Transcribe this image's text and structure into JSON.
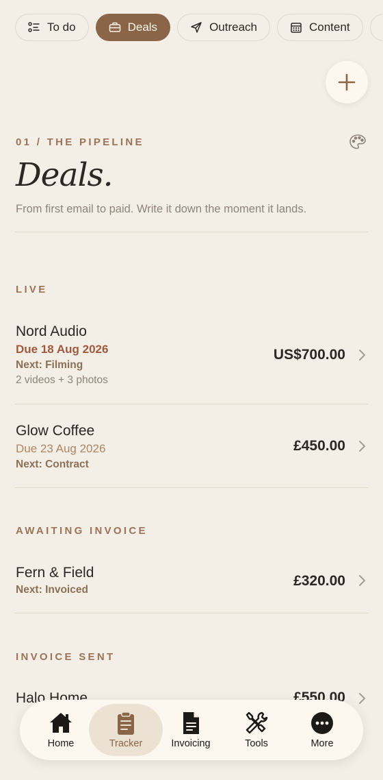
{
  "tabs": [
    {
      "label": "To do",
      "icon": "checklist-icon"
    },
    {
      "label": "Deals",
      "icon": "briefcase-icon",
      "active": true
    },
    {
      "label": "Outreach",
      "icon": "paper-plane-icon"
    },
    {
      "label": "Content",
      "icon": "calendar-icon"
    }
  ],
  "header": {
    "eyebrow": "01 / THE PIPELINE",
    "title": "Deals.",
    "subtitle": "From first email to paid. Write it down the moment it lands."
  },
  "sections": {
    "live": "LIVE",
    "awaiting_invoice": "AWAITING INVOICE",
    "invoice_sent": "INVOICE SENT"
  },
  "deals": [
    {
      "name": "Nord Audio",
      "due": "Due 18 Aug 2026",
      "next": "Next: Filming",
      "meta": "2 videos + 3 photos",
      "amount": "US$700.00"
    },
    {
      "name": "Glow Coffee",
      "due": "Due 23 Aug 2026",
      "next": "Next: Contract",
      "amount": "£450.00"
    },
    {
      "name": "Fern & Field",
      "next": "Next: Invoiced",
      "amount": "£320.00"
    },
    {
      "name": "Halo Home",
      "amount": "£550.00"
    }
  ],
  "nav": [
    {
      "label": "Home",
      "icon": "home-icon"
    },
    {
      "label": "Tracker",
      "icon": "clipboard-icon",
      "active": true
    },
    {
      "label": "Invoicing",
      "icon": "document-icon"
    },
    {
      "label": "Tools",
      "icon": "tools-icon"
    },
    {
      "label": "More",
      "icon": "more-icon"
    }
  ],
  "colors": {
    "background": "#f3eee6",
    "accent": "#8b6547",
    "due_urgent": "#a0593f",
    "due_soft": "#b08562",
    "eyebrow": "#9a7358"
  }
}
